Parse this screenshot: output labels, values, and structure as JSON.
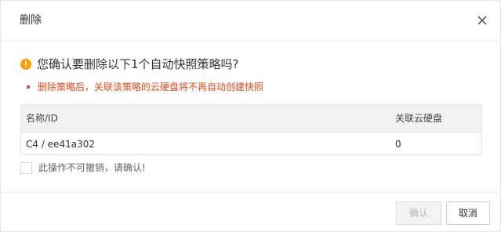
{
  "dialog": {
    "title": "删除",
    "close_icon": "close-icon"
  },
  "question": {
    "icon": "warning-circle-icon",
    "icon_color": "#ff9c00",
    "text": "您确认要删除以下1个自动快照策略吗?"
  },
  "warning": {
    "text": "删除策略后，关联该策略的云硬盘将不再自动创建快照",
    "color": "#e8481f"
  },
  "table": {
    "columns": [
      "名称/ID",
      "关联云硬盘"
    ],
    "rows": [
      [
        "C4 / ee41a302",
        "0"
      ]
    ]
  },
  "confirm_checkbox": {
    "label": "此操作不可撤销，请确认!",
    "checked": false
  },
  "footer": {
    "ok_label": "确认",
    "ok_disabled": true,
    "cancel_label": "取消"
  }
}
